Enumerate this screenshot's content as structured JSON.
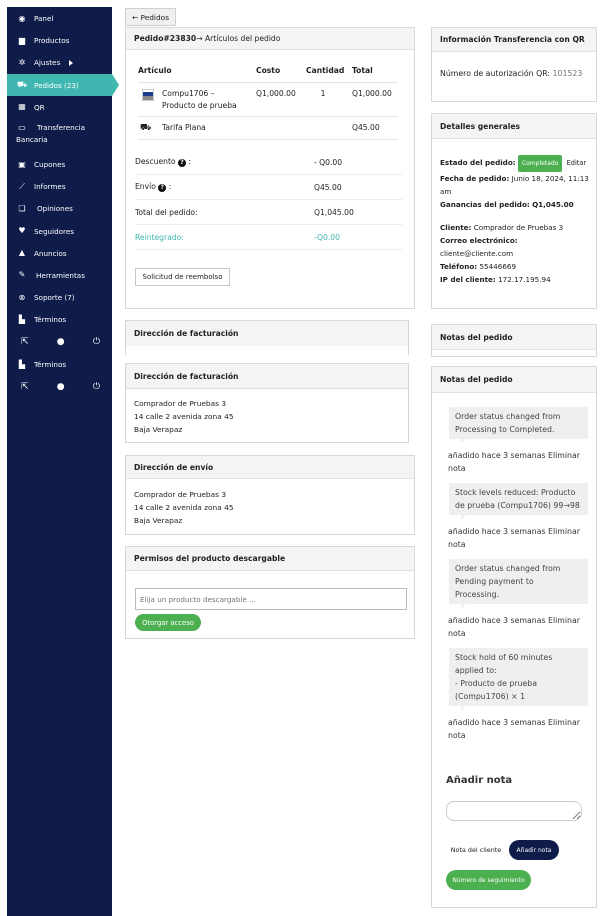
{
  "sidebar": {
    "items": [
      {
        "label": "Panel",
        "icon": "dashboard-icon"
      },
      {
        "label": "Productos",
        "icon": "briefcase-icon"
      },
      {
        "label": "Ajustes",
        "icon": "gear-icon"
      },
      {
        "label": "Pedidos (23)",
        "icon": "cart-icon"
      },
      {
        "label": "QR",
        "icon": "qr-icon"
      },
      {
        "label_line1": "Transferencia",
        "label_line2": "Bancaria",
        "icon": "bank-card-icon"
      },
      {
        "label": "Cupones",
        "icon": "gift-icon"
      },
      {
        "label": "Informes",
        "icon": "chart-icon"
      },
      {
        "label": "Opiniones",
        "icon": "comments-icon"
      },
      {
        "label": "Seguidores",
        "icon": "heart-icon"
      },
      {
        "label": "Anuncios",
        "icon": "bell-icon"
      },
      {
        "label": "Herramientas",
        "icon": "wrench-icon"
      },
      {
        "label": "Soporte (7)",
        "icon": "support-icon"
      },
      {
        "label": "Términos",
        "icon": "document-icon"
      },
      {
        "label": "Términos",
        "icon": "document-icon"
      }
    ]
  },
  "back_button": "← Pedidos",
  "order": {
    "header_number": "Pedido#23830",
    "header_suffix": " → Artículos del pedido",
    "columns": [
      "Artículo",
      "Costo",
      "Cantidad",
      "Total"
    ],
    "item": {
      "name_line1": "Compu1706 –",
      "name_line2": "Producto de prueba",
      "cost": "Q1,000.00",
      "qty": "1",
      "total": "Q1,000.00"
    },
    "shipping": {
      "name": "Tarifa Plana",
      "total": "Q45.00"
    },
    "discount_label": "Descuento",
    "discount_value": "- Q0.00",
    "shipping_label": "Envío",
    "shipping_value": "Q45.00",
    "total_label": "Total del pedido:",
    "total_value": "Q1,045.00",
    "refunded_label": "Reintegrado:",
    "refunded_value": "-Q0.00",
    "refund_button": "Solicitud de reembolso"
  },
  "billing_empty_title": "Dirección de facturación",
  "billing": {
    "title": "Dirección de facturación",
    "lines": [
      "Comprador de Pruebas 3",
      "14 calle 2 avenida zona 45",
      "Baja Verapaz"
    ]
  },
  "shipping_address": {
    "title": "Dirección de envío",
    "lines": [
      "Comprador de Pruebas 3",
      "14 calle 2 avenida zona 45",
      "Baja Verapaz"
    ]
  },
  "downloads": {
    "title": "Permisos del producto descargable",
    "placeholder": "Elija un producto descargable ...",
    "grant_button": "Otorgar acceso"
  },
  "qr_info": {
    "title": "Información Transferencia con QR",
    "auth_label": "Número de autorización QR:",
    "auth_value": "101523"
  },
  "general": {
    "title": "Detalles generales",
    "status_label": "Estado del pedido:",
    "status_value": "Completado",
    "edit_link": "Editar",
    "date_label": "Fecha de pedido:",
    "date_value": "Junio 18, 2024, 11:13",
    "date_value2": "am",
    "earnings_label": "Ganancias del pedido:",
    "earnings_value": "Q1,045.00",
    "client_label": "Cliente:",
    "client_value": "Comprador de Pruebas 3",
    "email_label": "Correo electrónico:",
    "email_value": "cliente@cliente.com",
    "phone_label": "Teléfono:",
    "phone_value": "55446669",
    "ip_label": "IP del cliente:",
    "ip_value": "172.17.195.94"
  },
  "notes_empty_title": "Notas del pedido",
  "notes": {
    "title": "Notas del pedido",
    "items": [
      {
        "lines": [
          "Order status changed from",
          "Processing to Completed."
        ],
        "meta1": "añadido hace 3 semanas",
        "delete": "Eliminar",
        "meta2": "nota"
      },
      {
        "lines": [
          "Stock levels reduced: Producto",
          "de prueba (Compu1706) 99→98"
        ],
        "meta1": "añadido hace 3 semanas",
        "delete": "Eliminar",
        "meta2": "nota"
      },
      {
        "lines": [
          "Order status changed from",
          "Pending payment to",
          "Processing."
        ],
        "meta1": "añadido hace 3 semanas",
        "delete": "Eliminar",
        "meta2": "nota"
      },
      {
        "lines": [
          "Stock hold of 60 minutes",
          "applied to:",
          "- Producto de prueba",
          "(Compu1706) × 1"
        ],
        "meta1": "añadido hace 3 semanas",
        "delete": "Eliminar",
        "meta2": "nota"
      }
    ],
    "add_title": "Añadir nota",
    "note_type": "Nota del cliente",
    "add_button": "Añadir nota",
    "tracking_button": "Número de seguimiento"
  },
  "colors": {
    "sidebar": "#0f1c4a",
    "active": "#3fb6b0",
    "green": "#4caf50",
    "dark_button": "#0f1c4a",
    "refund": "#3fb6b0"
  }
}
